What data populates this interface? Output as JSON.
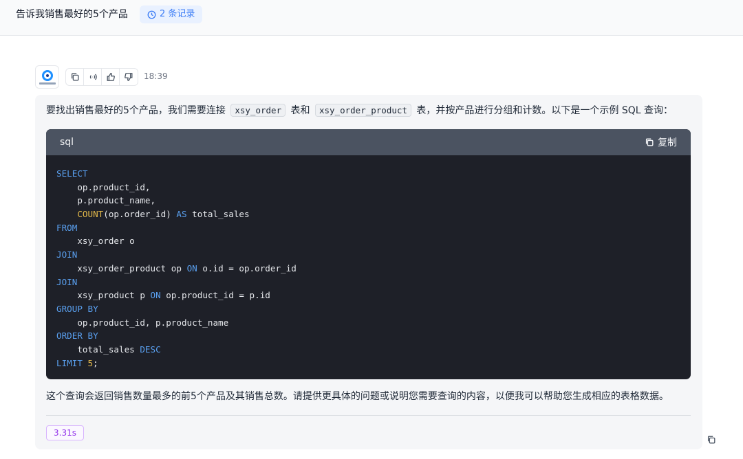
{
  "header": {
    "question": "告诉我销售最好的5个产品",
    "records_label": "2 条记录"
  },
  "message": {
    "time": "18:39",
    "actions": [
      "copy-icon",
      "speaker-icon",
      "thumbs-up-icon",
      "thumbs-down-icon"
    ],
    "intro_before": "要找出销售最好的5个产品，我们需要连接",
    "intro_code1": "xsy_order",
    "intro_middle": "表和",
    "intro_code2": "xsy_order_product",
    "intro_after": "表，并按产品进行分组和计数。以下是一个示例 SQL 查询：",
    "code_lang": "sql",
    "copy_label": "复制",
    "code_lines": [
      [
        {
          "t": "SELECT",
          "c": "kw"
        }
      ],
      [
        {
          "t": "    op.product_id,",
          "c": ""
        }
      ],
      [
        {
          "t": "    p.product_name,",
          "c": ""
        }
      ],
      [
        {
          "t": "    ",
          "c": ""
        },
        {
          "t": "COUNT",
          "c": "fn"
        },
        {
          "t": "(op.order_id) ",
          "c": ""
        },
        {
          "t": "AS",
          "c": "kw"
        },
        {
          "t": " total_sales",
          "c": ""
        }
      ],
      [
        {
          "t": "FROM",
          "c": "kw"
        }
      ],
      [
        {
          "t": "    xsy_order o",
          "c": ""
        }
      ],
      [
        {
          "t": "JOIN",
          "c": "kw"
        }
      ],
      [
        {
          "t": "    xsy_order_product op ",
          "c": ""
        },
        {
          "t": "ON",
          "c": "kw"
        },
        {
          "t": " o.id = op.order_id",
          "c": ""
        }
      ],
      [
        {
          "t": "JOIN",
          "c": "kw"
        }
      ],
      [
        {
          "t": "    xsy_product p ",
          "c": ""
        },
        {
          "t": "ON",
          "c": "kw"
        },
        {
          "t": " op.product_id = p.id",
          "c": ""
        }
      ],
      [
        {
          "t": "GROUP BY",
          "c": "kw"
        }
      ],
      [
        {
          "t": "    op.product_id, p.product_name",
          "c": ""
        }
      ],
      [
        {
          "t": "ORDER BY",
          "c": "kw"
        }
      ],
      [
        {
          "t": "    total_sales ",
          "c": ""
        },
        {
          "t": "DESC",
          "c": "kw"
        }
      ],
      [
        {
          "t": "LIMIT ",
          "c": "kw"
        },
        {
          "t": "5",
          "c": "num"
        },
        {
          "t": ";",
          "c": ""
        }
      ]
    ],
    "summary": "这个查询会返回销售数量最多的前5个产品及其销售总数。请提供更具体的问题或说明您需要查询的内容，以便我可以帮助您生成相应的表格数据。",
    "duration": "3.31s"
  },
  "colors": {
    "accent": "#3b7cf6",
    "keyword": "#5aa0f0",
    "function": "#e2b84a",
    "duration_badge": "#9333ea"
  }
}
